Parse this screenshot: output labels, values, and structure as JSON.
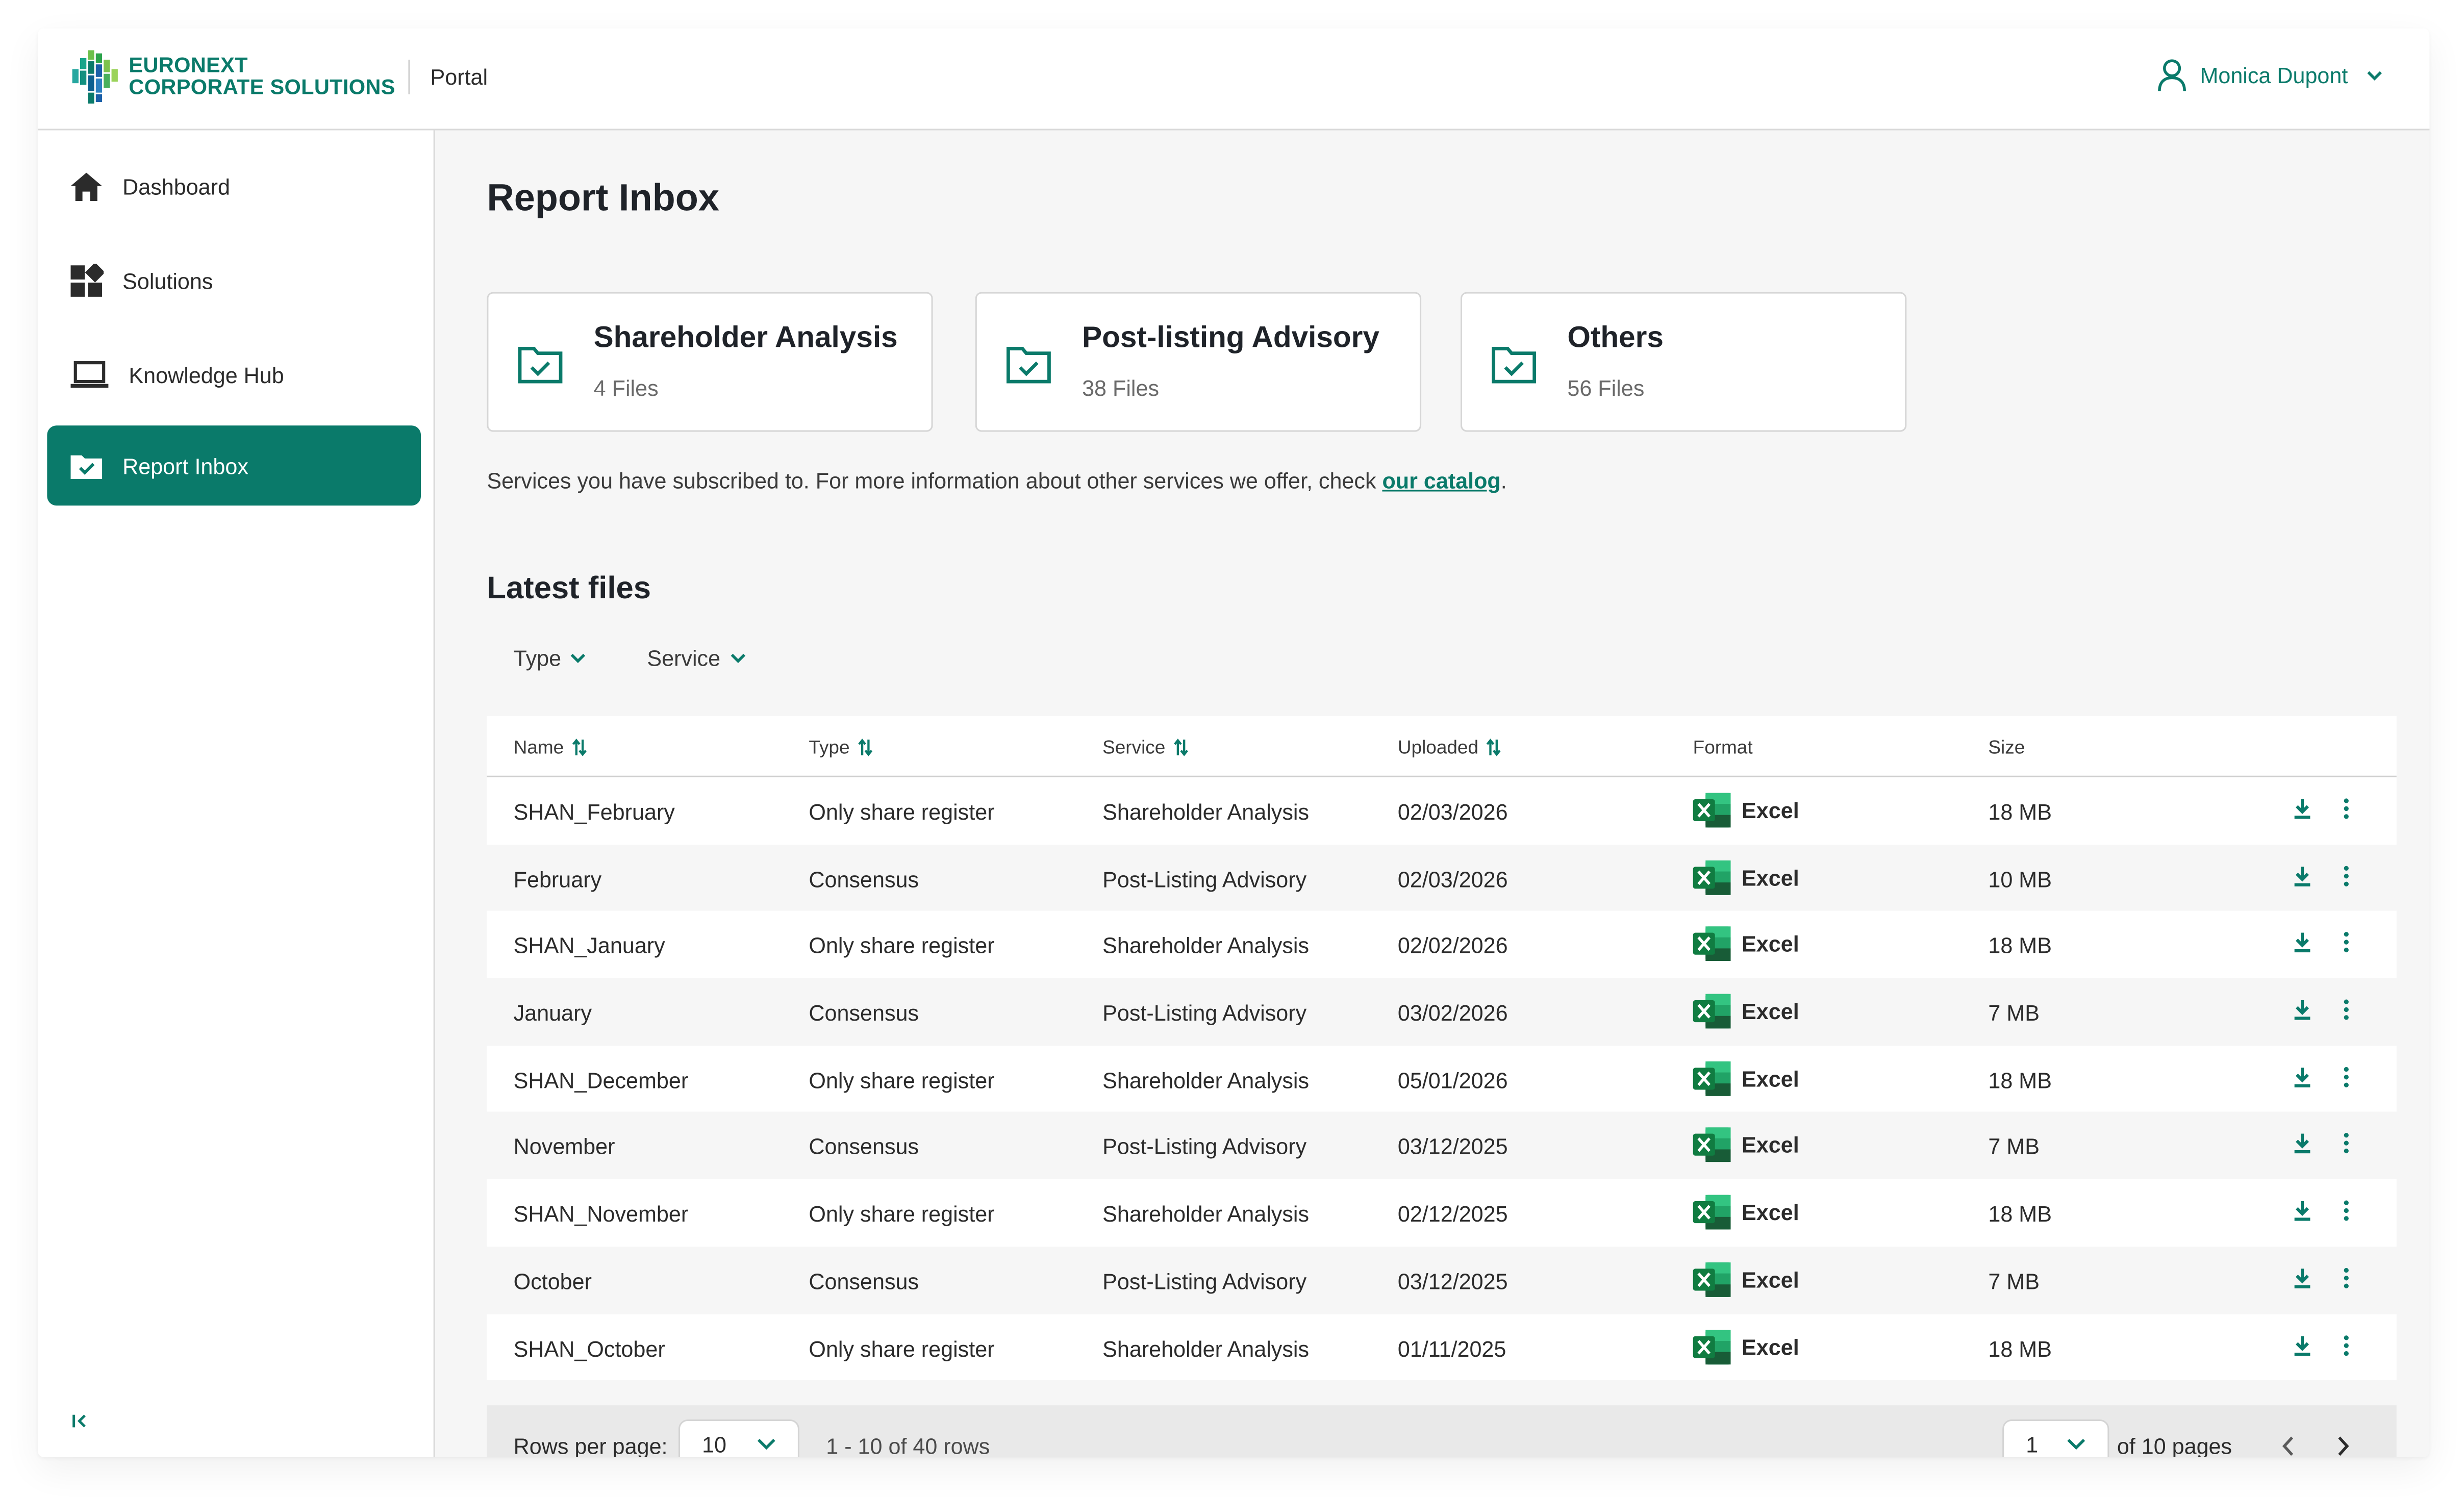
{
  "header": {
    "brand_line1": "EURONEXT",
    "brand_line2": "CORPORATE SOLUTIONS",
    "portal_label": "Portal",
    "user_name": "Monica Dupont",
    "user_icon": "user-icon",
    "dropdown_icon": "chevron-down-icon"
  },
  "sidebar": {
    "items": [
      {
        "label": "Dashboard",
        "icon": "home-icon"
      },
      {
        "label": "Solutions",
        "icon": "grid-icon"
      },
      {
        "label": "Knowledge Hub",
        "icon": "laptop-icon"
      },
      {
        "label": "Report Inbox",
        "icon": "folder-check-icon",
        "active": true
      }
    ],
    "collapse_icon": "collapse-sidebar-icon"
  },
  "main": {
    "title": "Report Inbox",
    "cards": [
      {
        "title": "Shareholder Analysis",
        "count": "4 Files"
      },
      {
        "title": "Post-listing Advisory",
        "count": "38 Files"
      },
      {
        "title": "Others",
        "count": "56 Files"
      }
    ],
    "notice_text": "Services you have subscribed to. For more information about other services we offer, check ",
    "notice_link": "our catalog",
    "notice_end": ".",
    "latest_title": "Latest files",
    "filters": {
      "type": "Type",
      "service": "Service"
    }
  },
  "table": {
    "headers": {
      "name": "Name",
      "type": "Type",
      "service": "Service",
      "uploaded": "Uploaded",
      "format": "Format",
      "size": "Size"
    },
    "rows": [
      {
        "name": "SHAN_February",
        "type": "Only share register",
        "service": "Shareholder Analysis",
        "uploaded": "02/03/2026",
        "format": "Excel",
        "size": "18 MB"
      },
      {
        "name": "February",
        "type": "Consensus",
        "service": "Post-Listing Advisory",
        "uploaded": "02/03/2026",
        "format": "Excel",
        "size": "10 MB"
      },
      {
        "name": "SHAN_January",
        "type": "Only share register",
        "service": "Shareholder Analysis",
        "uploaded": "02/02/2026",
        "format": "Excel",
        "size": "18 MB"
      },
      {
        "name": "January",
        "type": "Consensus",
        "service": "Post-Listing Advisory",
        "uploaded": "03/02/2026",
        "format": "Excel",
        "size": "7 MB"
      },
      {
        "name": "SHAN_December",
        "type": "Only share register",
        "service": "Shareholder Analysis",
        "uploaded": "05/01/2026",
        "format": "Excel",
        "size": "18 MB"
      },
      {
        "name": "November",
        "type": "Consensus",
        "service": "Post-Listing Advisory",
        "uploaded": "03/12/2025",
        "format": "Excel",
        "size": "7 MB"
      },
      {
        "name": "SHAN_November",
        "type": "Only share register",
        "service": "Shareholder Analysis",
        "uploaded": "02/12/2025",
        "format": "Excel",
        "size": "18 MB"
      },
      {
        "name": "October",
        "type": "Consensus",
        "service": "Post-Listing Advisory",
        "uploaded": "03/12/2025",
        "format": "Excel",
        "size": "7 MB"
      },
      {
        "name": "SHAN_October",
        "type": "Only share register",
        "service": "Shareholder Analysis",
        "uploaded": "01/11/2025",
        "format": "Excel",
        "size": "18 MB"
      }
    ]
  },
  "pagination": {
    "rows_per_page_label": "Rows per page:",
    "rows_per_page_value": "10",
    "range_text": "1 - 10 of 40 rows",
    "page_value": "1",
    "pages_text": "of 10 pages"
  },
  "colors": {
    "accent": "#0a7a6a",
    "excel_green": "#1e7a43"
  }
}
